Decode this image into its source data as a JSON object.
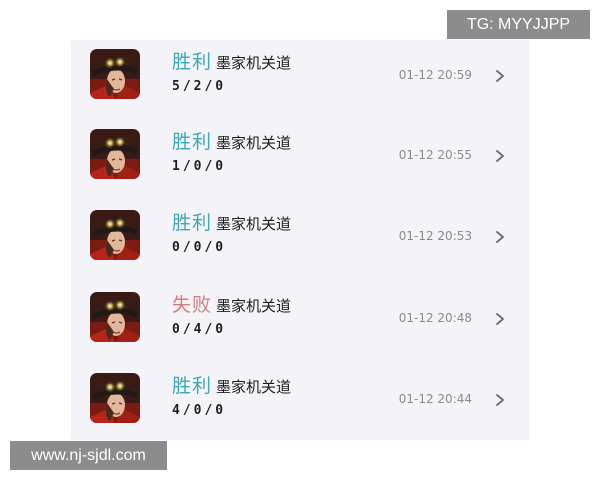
{
  "watermarks": {
    "top_right": "TG: MYYJJPP",
    "bottom_left": "www.nj-sjdl.com"
  },
  "colors": {
    "win": "#3fa6b5",
    "lose": "#d77a80",
    "panel_bg": "#f4f4f8"
  },
  "matches": [
    {
      "result": "胜利",
      "outcome": "win",
      "mode": "墨家机关道",
      "kda": "5/2/0",
      "time": "01-12 20:59",
      "avatar_icon": "hero-portrait-icon",
      "arrow_icon": "chevron-right-icon"
    },
    {
      "result": "胜利",
      "outcome": "win",
      "mode": "墨家机关道",
      "kda": "1/0/0",
      "time": "01-12 20:55",
      "avatar_icon": "hero-portrait-icon",
      "arrow_icon": "chevron-right-icon"
    },
    {
      "result": "胜利",
      "outcome": "win",
      "mode": "墨家机关道",
      "kda": "0/0/0",
      "time": "01-12 20:53",
      "avatar_icon": "hero-portrait-icon",
      "arrow_icon": "chevron-right-icon"
    },
    {
      "result": "失败",
      "outcome": "lose",
      "mode": "墨家机关道",
      "kda": "0/4/0",
      "time": "01-12 20:48",
      "avatar_icon": "hero-portrait-icon",
      "arrow_icon": "chevron-right-icon"
    },
    {
      "result": "胜利",
      "outcome": "win",
      "mode": "墨家机关道",
      "kda": "4/0/0",
      "time": "01-12 20:44",
      "avatar_icon": "hero-portrait-icon",
      "arrow_icon": "chevron-right-icon"
    }
  ]
}
